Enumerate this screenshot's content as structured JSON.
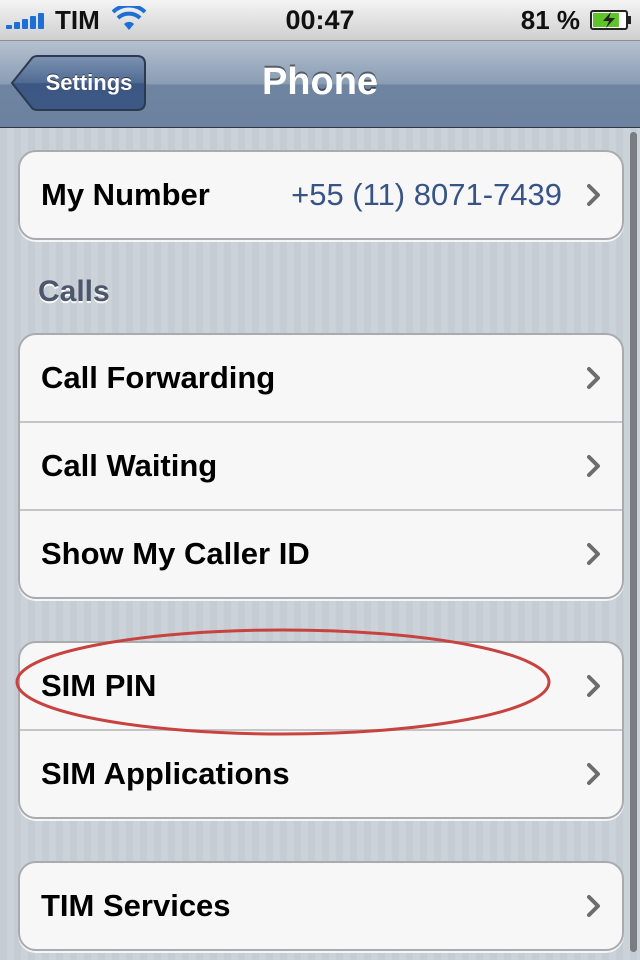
{
  "status_bar": {
    "carrier": "TIM",
    "time": "00:47",
    "battery_percent": "81 %",
    "battery_level": 0.81,
    "signal_icon": "signal-bars-icon",
    "wifi_icon": "wifi-icon",
    "battery_icon": "battery-charging-icon"
  },
  "nav": {
    "back_label": "Settings",
    "title": "Phone"
  },
  "groups": {
    "number": {
      "label": "My Number",
      "value": "+55 (11) 8071-7439"
    },
    "calls_header": "Calls",
    "calls": [
      {
        "label": "Call Forwarding"
      },
      {
        "label": "Call Waiting"
      },
      {
        "label": "Show My Caller ID"
      }
    ],
    "sim": [
      {
        "label": "SIM PIN"
      },
      {
        "label": "SIM Applications"
      }
    ],
    "carrier_services": {
      "label": "TIM Services"
    }
  },
  "colors": {
    "accent_value": "#385487",
    "highlight_ring": "#c8433f",
    "navbar": "#6f84a0"
  }
}
